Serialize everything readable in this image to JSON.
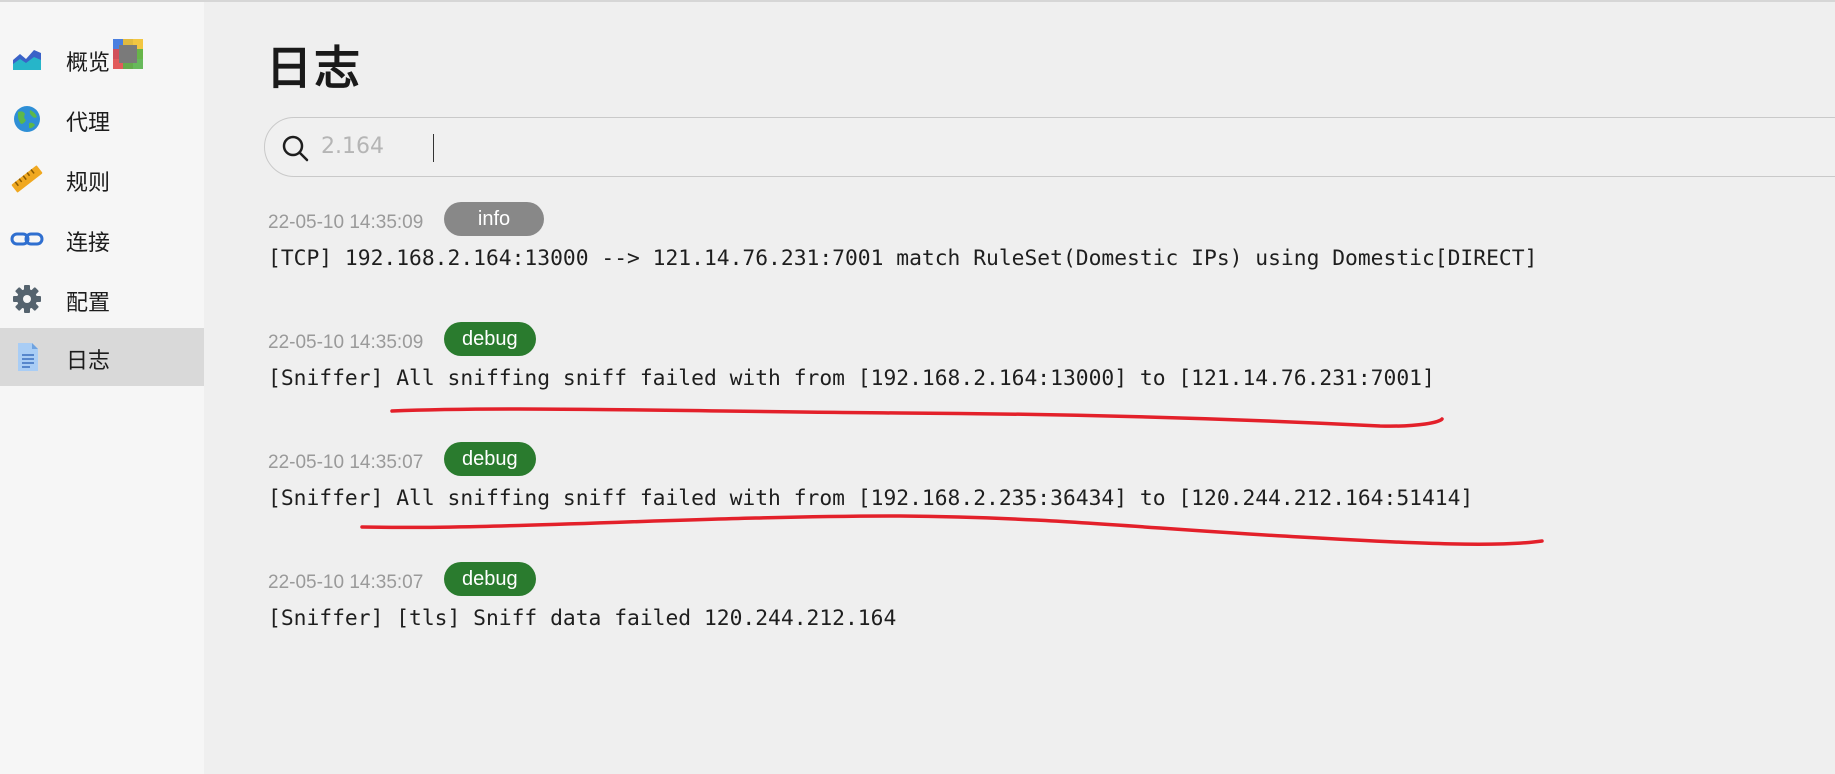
{
  "sidebar": {
    "items": [
      {
        "label": "概览",
        "icon": "chart-area-icon"
      },
      {
        "label": "代理",
        "icon": "globe-icon"
      },
      {
        "label": "规则",
        "icon": "ruler-icon"
      },
      {
        "label": "连接",
        "icon": "link-icon"
      },
      {
        "label": "配置",
        "icon": "gear-icon"
      },
      {
        "label": "日志",
        "icon": "document-icon",
        "active": true
      }
    ]
  },
  "main": {
    "title": "日志",
    "search": {
      "value": "2.164"
    },
    "logs": [
      {
        "time": "22-05-10 14:35:09",
        "level": "info",
        "message": "[TCP] 192.168.2.164:13000 --> 121.14.76.231:7001 match RuleSet(Domestic IPs) using Domestic[DIRECT]"
      },
      {
        "time": "22-05-10 14:35:09",
        "level": "debug",
        "message": "[Sniffer] All sniffing sniff failed with from [192.168.2.164:13000] to [121.14.76.231:7001]"
      },
      {
        "time": "22-05-10 14:35:07",
        "level": "debug",
        "message": "[Sniffer] All sniffing sniff failed with from [192.168.2.235:36434] to [120.244.212.164:51414]"
      },
      {
        "time": "22-05-10 14:35:07",
        "level": "debug",
        "message": "[Sniffer] [tls] Sniff data failed 120.244.212.164"
      }
    ]
  },
  "colors": {
    "info_badge": "#888888",
    "debug_badge": "#2a7b2e",
    "annotation_red": "#e3202a",
    "active_nav": "#d9d9d9"
  }
}
